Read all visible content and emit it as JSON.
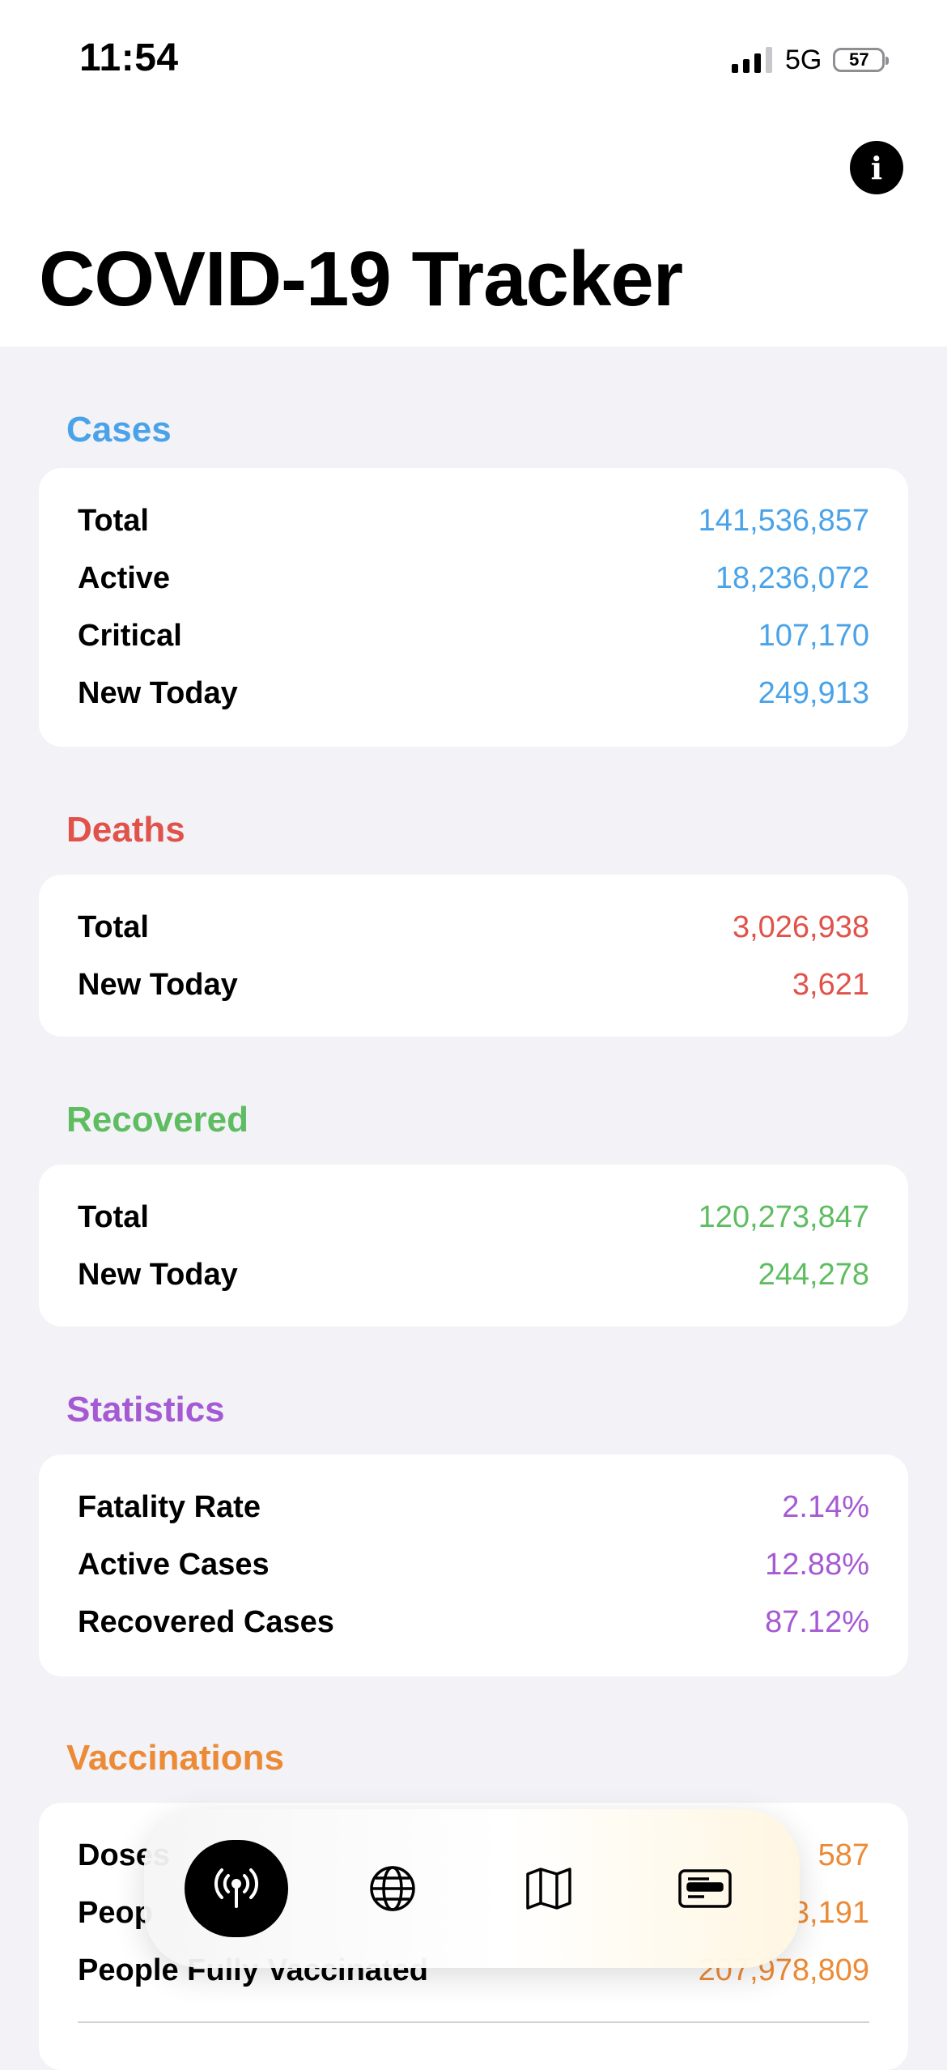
{
  "status_bar": {
    "time": "11:54",
    "network": "5G",
    "battery": "57"
  },
  "title": "COVID-19 Tracker",
  "colors": {
    "cases": "#4aa3e8",
    "deaths": "#e0524a",
    "recovered": "#5fbd61",
    "statistics": "#a55ad3",
    "vaccinations": "#ec8a35"
  },
  "sections": {
    "cases": {
      "title": "Cases",
      "rows": [
        {
          "label": "Total",
          "value": "141,536,857"
        },
        {
          "label": "Active",
          "value": "18,236,072"
        },
        {
          "label": "Critical",
          "value": "107,170"
        },
        {
          "label": "New Today",
          "value": "249,913"
        }
      ]
    },
    "deaths": {
      "title": "Deaths",
      "rows": [
        {
          "label": "Total",
          "value": "3,026,938"
        },
        {
          "label": "New Today",
          "value": "3,621"
        }
      ]
    },
    "recovered": {
      "title": "Recovered",
      "rows": [
        {
          "label": "Total",
          "value": "120,273,847"
        },
        {
          "label": "New Today",
          "value": "244,278"
        }
      ]
    },
    "statistics": {
      "title": "Statistics",
      "rows": [
        {
          "label": "Fatality Rate",
          "value": "2.14%"
        },
        {
          "label": "Active Cases",
          "value": "12.88%"
        },
        {
          "label": "Recovered Cases",
          "value": "87.12%"
        }
      ]
    },
    "vaccinations": {
      "title": "Vaccinations",
      "rows": [
        {
          "label": "Doses",
          "value": "587"
        },
        {
          "label": "Peop",
          "value": "3,191"
        },
        {
          "label": "People Fully Vaccinated",
          "value": "207,978,809"
        }
      ]
    }
  },
  "tabbar": {
    "tabs": [
      {
        "icon": "antenna-icon",
        "active": true
      },
      {
        "icon": "globe-icon",
        "active": false
      },
      {
        "icon": "map-icon",
        "active": false
      },
      {
        "icon": "news-card-icon",
        "active": false
      }
    ]
  }
}
